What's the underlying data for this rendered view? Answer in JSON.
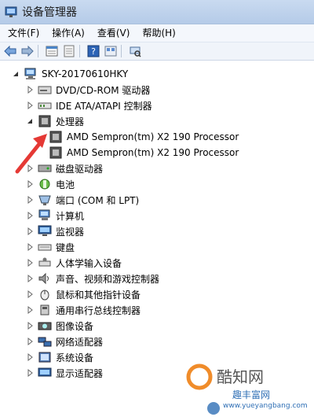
{
  "window": {
    "title": "设备管理器"
  },
  "menu": [
    {
      "label": "文件(F)"
    },
    {
      "label": "操作(A)"
    },
    {
      "label": "查看(V)"
    },
    {
      "label": "帮助(H)"
    }
  ],
  "toolbar": {
    "icons": [
      "back-icon",
      "forward-icon",
      "properties-icon",
      "scan-icon",
      "help-icon",
      "view-icon",
      "device-icon"
    ]
  },
  "tree": {
    "root": "SKY-20170610HKY",
    "nodes": [
      {
        "label": "DVD/CD-ROM 驱动器",
        "icon": "dvd-icon"
      },
      {
        "label": "IDE ATA/ATAPI 控制器",
        "icon": "ide-icon"
      },
      {
        "label": "处理器",
        "icon": "cpu-icon",
        "expanded": true,
        "children": [
          {
            "label": "AMD Sempron(tm) X2 190 Processor",
            "icon": "cpu-icon"
          },
          {
            "label": "AMD Sempron(tm) X2 190 Processor",
            "icon": "cpu-icon"
          }
        ]
      },
      {
        "label": "磁盘驱动器",
        "icon": "disk-icon"
      },
      {
        "label": "电池",
        "icon": "battery-icon"
      },
      {
        "label": "端口 (COM 和 LPT)",
        "icon": "port-icon"
      },
      {
        "label": "计算机",
        "icon": "computer-icon"
      },
      {
        "label": "监视器",
        "icon": "monitor-icon"
      },
      {
        "label": "键盘",
        "icon": "keyboard-icon"
      },
      {
        "label": "人体学输入设备",
        "icon": "hid-icon"
      },
      {
        "label": "声音、视频和游戏控制器",
        "icon": "sound-icon"
      },
      {
        "label": "鼠标和其他指针设备",
        "icon": "mouse-icon"
      },
      {
        "label": "通用串行总线控制器",
        "icon": "usb-icon"
      },
      {
        "label": "图像设备",
        "icon": "camera-icon"
      },
      {
        "label": "网络适配器",
        "icon": "network-icon"
      },
      {
        "label": "系统设备",
        "icon": "system-icon"
      },
      {
        "label": "显示适配器",
        "icon": "display-icon"
      }
    ]
  },
  "watermark": {
    "brand": "酷知网",
    "site": "www.yueyangbang.com",
    "slogan": "趣丰富网"
  },
  "colors": {
    "arrow": "#e53935",
    "accent": "#2f6fb5"
  }
}
